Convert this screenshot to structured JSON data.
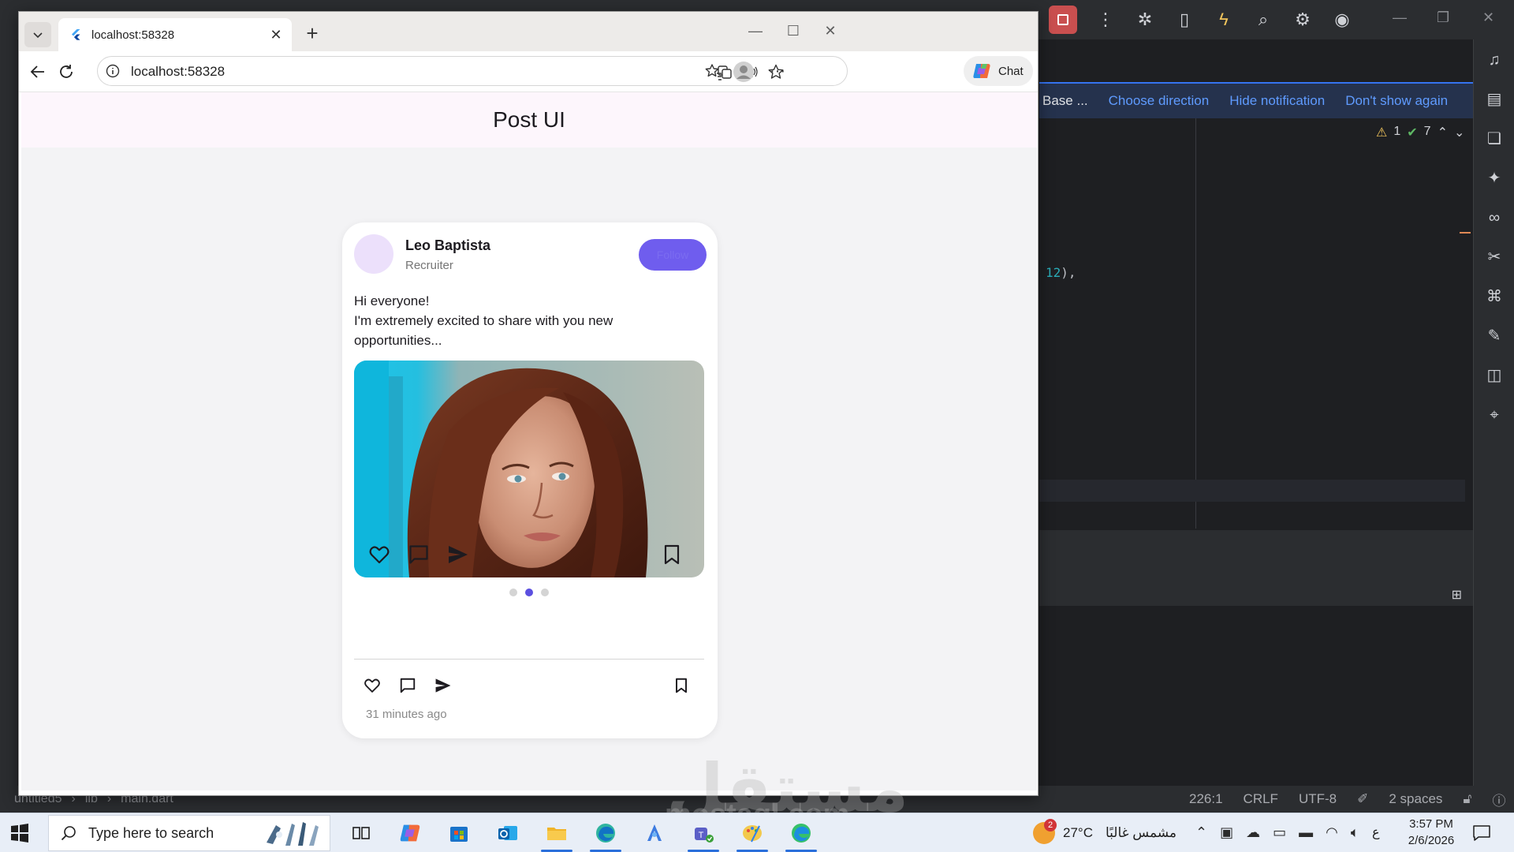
{
  "browser": {
    "tab_title": "localhost:58328",
    "address": "localhost:58328",
    "chat_label": "Chat"
  },
  "app": {
    "appbar_title": "Post UI"
  },
  "post": {
    "user_name": "Leo Baptista",
    "user_role": "Recruiter",
    "follow_label": "Follow",
    "text_line1": "Hi everyone!",
    "text_line2": "I'm extremely excited to share with you new",
    "text_line3": "opportunities...",
    "carousel_active_index": 1,
    "carousel_count": 3,
    "timestamp": "31 minutes ago"
  },
  "ide": {
    "notification_first": "Base ...",
    "notification_actions": [
      "Choose direction",
      "Hide notification",
      "Don't show again"
    ],
    "warning_count": "1",
    "check_count": "7",
    "code_value": "12",
    "code_suffix": "),",
    "breadcrumb": [
      "untitled5",
      "lib",
      "main.dart"
    ],
    "status_position": "226:1",
    "status_line_ending": "CRLF",
    "status_encoding": "UTF-8",
    "status_indent": "2 spaces"
  },
  "taskbar": {
    "search_placeholder": "Type here to search",
    "weather_temp": "27°C",
    "weather_desc": "مشمس غالبًا",
    "weather_badge": "2",
    "input_lang": "ع",
    "time": "3:57 PM",
    "date": "2/6/2026"
  },
  "watermark": {
    "arabic": "مستقل",
    "latin": "mostaql.com"
  },
  "colors": {
    "accent": "#6f5dee",
    "dot_active": "#5b4fe0",
    "appbar_bg": "#fdf6fc",
    "ide_bg": "#1e1f22",
    "ide_link": "#5f9bff"
  }
}
